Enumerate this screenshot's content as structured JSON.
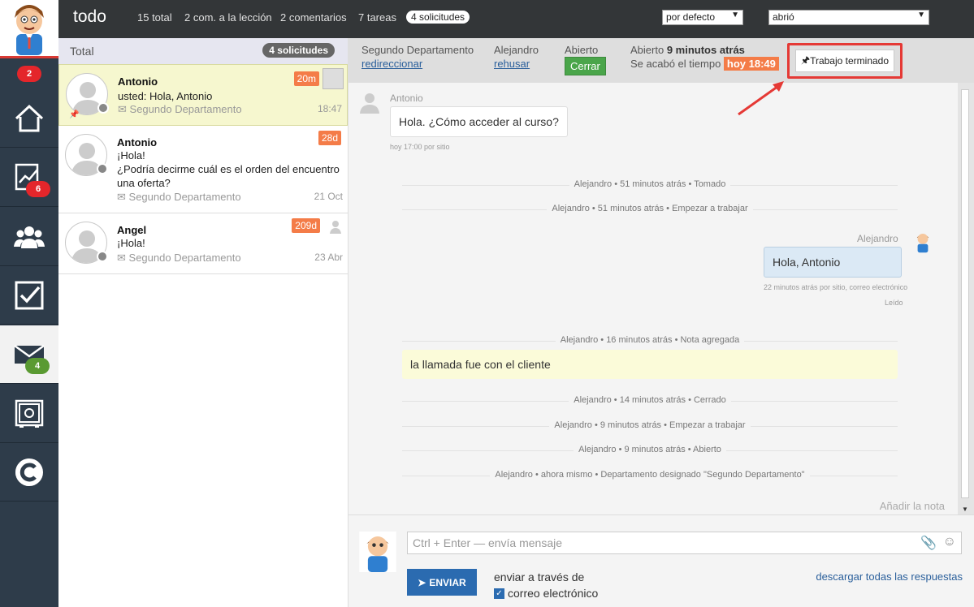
{
  "sidebar": {
    "badges": {
      "main": "2",
      "stats": "6",
      "mail": "4"
    }
  },
  "topbar": {
    "title": "todo",
    "links": [
      "15 total",
      "2 com. a la lección",
      "2 comentarios",
      "7 tareas"
    ],
    "active_pill": "4 solicitudes",
    "sort_select": "por defecto",
    "status_select": "abrió"
  },
  "list": {
    "header": "Total",
    "count_pill": "4 solicitudes",
    "items": [
      {
        "name": "Antonio",
        "text": "usted: Hola, Antonio",
        "dept": "Segundo Departamento",
        "date": "18:47",
        "age": "20m"
      },
      {
        "name": "Antonio",
        "text": "¡Hola!",
        "text2": "¿Podría decirme cuál es el orden del encuentro una oferta?",
        "dept": "Segundo Departamento",
        "date": "21 Oct",
        "age": "28d"
      },
      {
        "name": "Angel",
        "text": "¡Hola!",
        "dept": "Segundo Departamento",
        "date": "23 Abr",
        "age": "209d"
      }
    ]
  },
  "detail": {
    "dept_label": "Segundo Departamento",
    "redirect_link": "redireccionar",
    "agent_label": "Alejandro",
    "reject_link": "rehusar",
    "status_label": "Abierto",
    "close_button": "Cerrar",
    "opened_prefix": "Abierto",
    "opened_time": "9 minutos atrás",
    "timeout_label": "Se acabó el tiempo",
    "timeout_badge": "hoy 18:49",
    "done_button": "Trabajo terminado"
  },
  "messages": {
    "m1_author": "Antonio",
    "m1_text": "Hola. ¿Cómo acceder al curso?",
    "m1_meta": "hoy 17:00 por sitio",
    "s1": "Alejandro • 51 minutos atrás • Tomado",
    "s2": "Alejandro • 51 minutos atrás • Empezar a trabajar",
    "m2_author": "Alejandro",
    "m2_text": "Hola, Antonio",
    "m2_meta": "22 minutos atrás por sitio, correo electrónico",
    "m2_read": "Leído",
    "s3": "Alejandro • 16 minutos atrás • Nota agregada",
    "note_text": "la llamada fue con el cliente",
    "s4": "Alejandro • 14 minutos atrás • Cerrado",
    "s5": "Alejandro • 9 minutos atrás • Empezar a trabajar",
    "s6": "Alejandro • 9 minutos atrás • Abierto",
    "s7": "Alejandro • ahora mismo • Departamento designado \"Segundo Departamento\"",
    "add_note": "Añadir la nota"
  },
  "composer": {
    "placeholder": "Ctrl + Enter — envía mensaje",
    "send_button": "ENVIAR",
    "send_via": "enviar a través de",
    "email_option": "correo electrónico",
    "download_link": "descargar todas las respuestas"
  },
  "colors": {
    "sidebar": "#2e3c4a",
    "topbar": "#333638",
    "accent_orange": "#f47c48",
    "close_green": "#4aa54a",
    "send_blue": "#2b6bb0",
    "highlight_red": "#e53935"
  }
}
